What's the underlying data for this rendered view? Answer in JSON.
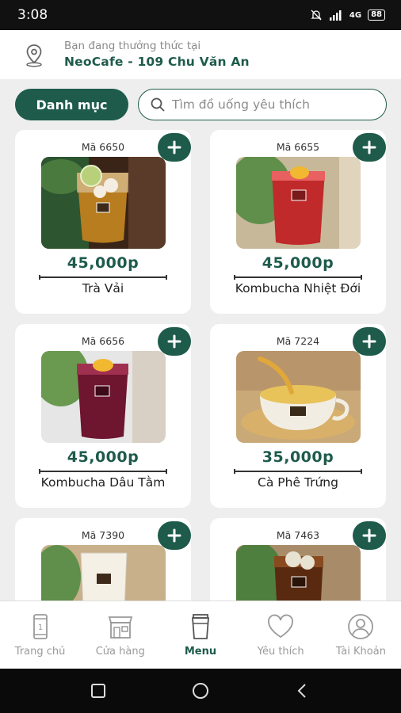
{
  "status_bar": {
    "time": "3:08",
    "network": "4G",
    "battery": "88"
  },
  "location": {
    "label": "Bạn đang thưởng thức tại",
    "store": "NeoCafe - 109 Chu Văn An"
  },
  "toolbar": {
    "category_label": "Danh mục",
    "search_placeholder": "Tìm đồ uống yêu thích"
  },
  "products": [
    {
      "code": "Mã 6650",
      "price": "45,000p",
      "name": "Trà Vải"
    },
    {
      "code": "Mã 6655",
      "price": "45,000p",
      "name": "Kombucha Nhiệt Đới"
    },
    {
      "code": "Mã 6656",
      "price": "45,000p",
      "name": "Kombucha Dâu Tằm"
    },
    {
      "code": "Mã 7224",
      "price": "35,000p",
      "name": "Cà Phê Trứng"
    },
    {
      "code": "Mã 7390"
    },
    {
      "code": "Mã 7463"
    }
  ],
  "bottom_nav": [
    {
      "label": "Trang chủ",
      "icon": "phone-icon"
    },
    {
      "label": "Cửa hàng",
      "icon": "store-icon"
    },
    {
      "label": "Menu",
      "icon": "cup-icon",
      "active": true
    },
    {
      "label": "Yêu thích",
      "icon": "heart-icon"
    },
    {
      "label": "Tài Khoản",
      "icon": "user-icon"
    }
  ],
  "colors": {
    "brand": "#1e5b4b",
    "background": "#eeeeee"
  }
}
